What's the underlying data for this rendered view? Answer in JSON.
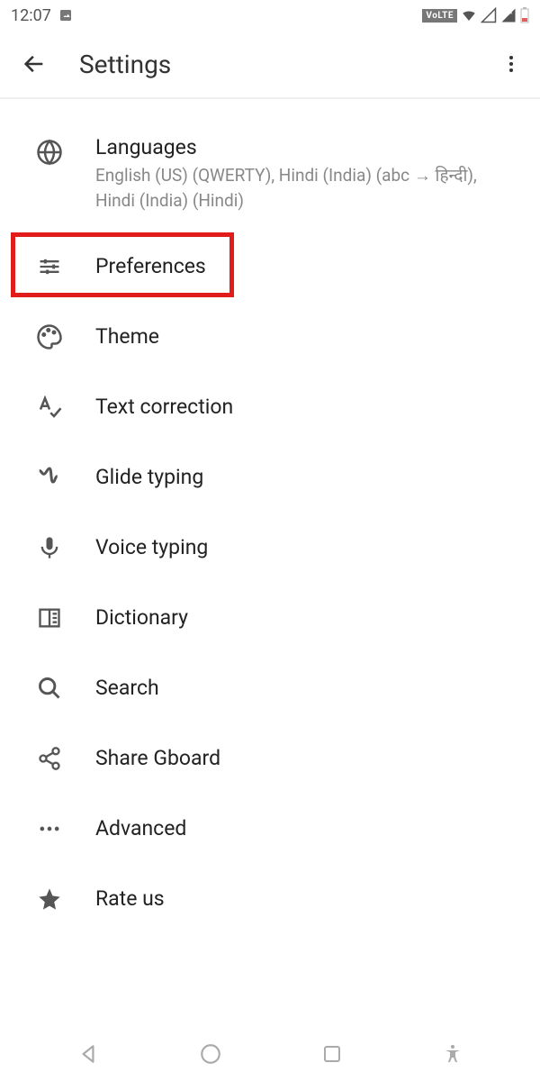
{
  "status": {
    "time": "12:07",
    "volte": "VoLTE"
  },
  "header": {
    "title": "Settings"
  },
  "items": {
    "languages": {
      "label": "Languages",
      "sub": "English (US) (QWERTY), Hindi (India) (abc → हिन्दी), Hindi (India) (Hindi)"
    },
    "preferences": {
      "label": "Preferences"
    },
    "theme": {
      "label": "Theme"
    },
    "text_correction": {
      "label": "Text correction"
    },
    "glide": {
      "label": "Glide typing"
    },
    "voice": {
      "label": "Voice typing"
    },
    "dictionary": {
      "label": "Dictionary"
    },
    "search": {
      "label": "Search"
    },
    "share": {
      "label": "Share Gboard"
    },
    "advanced": {
      "label": "Advanced"
    },
    "rate": {
      "label": "Rate us"
    }
  }
}
